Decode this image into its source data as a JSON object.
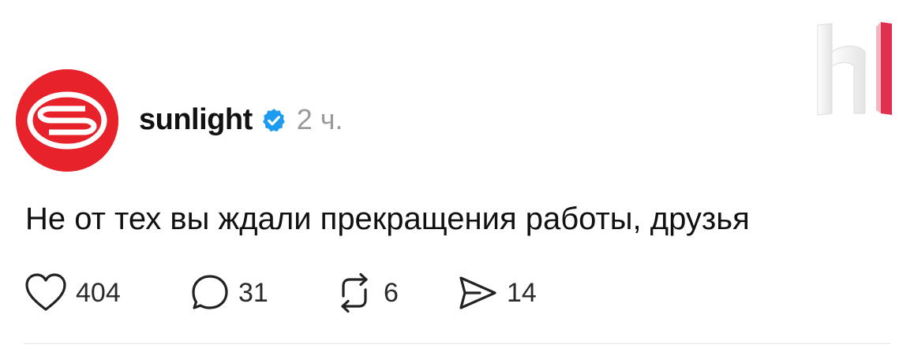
{
  "post": {
    "author": {
      "username": "sunlight",
      "verified": true,
      "avatar_icon": "sunlight-logo-icon",
      "avatar_color": "#e8222a"
    },
    "time_ago": "2 ч.",
    "text": "Не от тех вы ждали прекращения работы, друзья",
    "actions": {
      "likes": "404",
      "comments": "31",
      "reposts": "6",
      "shares": "14"
    }
  },
  "icons": {
    "verified": "verified-badge-icon",
    "like": "heart-icon",
    "comment": "comment-bubble-icon",
    "repost": "repost-icon",
    "share": "send-icon",
    "watermark": "watermark-logo-icon"
  },
  "colors": {
    "verified": "#1d9bf0",
    "watermark_accent": "#e0304f"
  }
}
